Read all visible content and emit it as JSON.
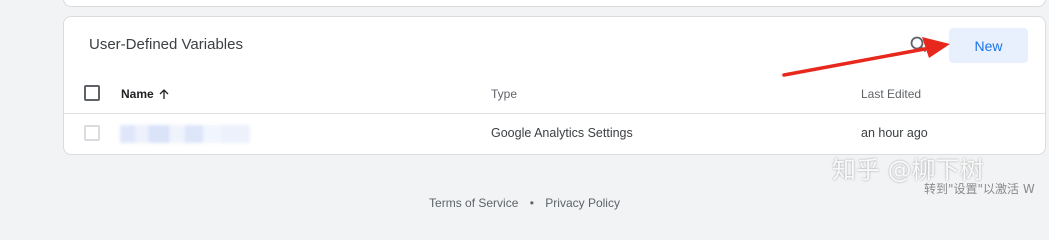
{
  "card": {
    "title": "User-Defined Variables",
    "new_button_label": "New"
  },
  "table": {
    "columns": [
      "Name",
      "Type",
      "Last Edited"
    ],
    "sort_direction": "ascending",
    "rows": [
      {
        "name": "",
        "type": "Google Analytics Settings",
        "last_edited": "an hour ago"
      }
    ]
  },
  "footer": {
    "links": [
      "Terms of Service",
      "Privacy Policy"
    ],
    "separator": "•"
  },
  "overlay": {
    "watermark": "知乎 @柳下树",
    "activation_text": "转到\"设置\"以激活 W"
  },
  "icons": {
    "search": "search-icon",
    "sort": "arrow-up-icon"
  },
  "colors": {
    "accent": "#1a73e8",
    "button_bg": "#e8f0fe",
    "annotation_arrow": "#e8281c"
  }
}
